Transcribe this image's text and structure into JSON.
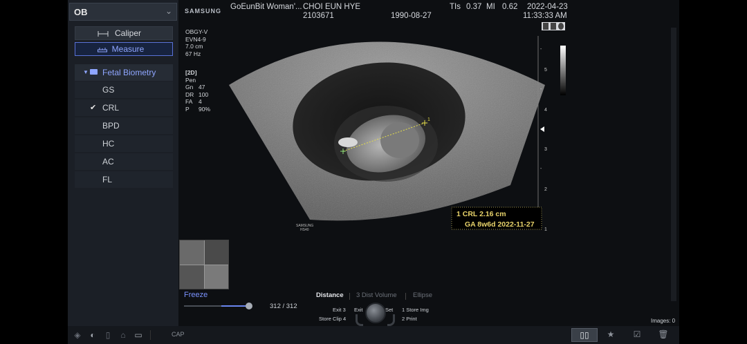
{
  "left_panel": {
    "mode_label": "OB",
    "tools": {
      "caliper_label": "Caliper",
      "measure_label": "Measure"
    },
    "group_label": "Fetal Biometry",
    "items": [
      {
        "label": "GS",
        "checked": false
      },
      {
        "label": "CRL",
        "checked": true
      },
      {
        "label": "BPD",
        "checked": false
      },
      {
        "label": "HC",
        "checked": false
      },
      {
        "label": "AC",
        "checked": false
      },
      {
        "label": "FL",
        "checked": false
      }
    ]
  },
  "header": {
    "brand": "SAMSUNG",
    "institution": "GoEunBit Woman'...",
    "patient_name": "CHOI EUN HYE",
    "patient_id": "2103671",
    "birth_date": "1990-08-27",
    "tis_label": "TIs",
    "tis_value": "0.37",
    "mi_label": "MI",
    "mi_value": "0.62",
    "date": "2022-04-23",
    "time": "11:33:33 AM"
  },
  "params": {
    "preset": "OBGY-V",
    "probe": "EVN4-9",
    "depth": "7.0 cm",
    "frame_rate": "67 Hz",
    "mode": "[2D]",
    "pen": "Pen",
    "gain_label": "Gn",
    "gain_value": "47",
    "dr_label": "DR",
    "dr_value": "100",
    "fa_label": "FA",
    "fa_value": "4",
    "p_label": "P",
    "p_value": "90%"
  },
  "image": {
    "watermark_line1": "SAMSUNG",
    "watermark_line2": "HS40",
    "scale_labels": [
      "5",
      "4",
      "3",
      "2",
      "1"
    ],
    "measurement_line1": "1 CRL  2.16 cm",
    "measurement_line2": "GA 8w6d 2022-11-27",
    "caliper_marker": "1"
  },
  "bottom": {
    "freeze_label": "Freeze",
    "frame_count": "312 / 312",
    "frame_progress": 1.0,
    "tabs": {
      "distance": "Distance",
      "dist_volume": "3 Dist Volume",
      "ellipse": "Ellipse"
    },
    "hints": {
      "exit3": "Exit 3",
      "store_clip": "Store Clip 4",
      "exit": "Exit",
      "set": "Set",
      "store_img": "1 Store Img",
      "print": "2 Print"
    },
    "images_count": "Images: 0",
    "cap_label": "CAP"
  },
  "colors": {
    "accent": "#7b93ff",
    "measurement": "#e8d36a",
    "caliper": "#e6df4a",
    "panel_bg": "#1b1f26"
  }
}
